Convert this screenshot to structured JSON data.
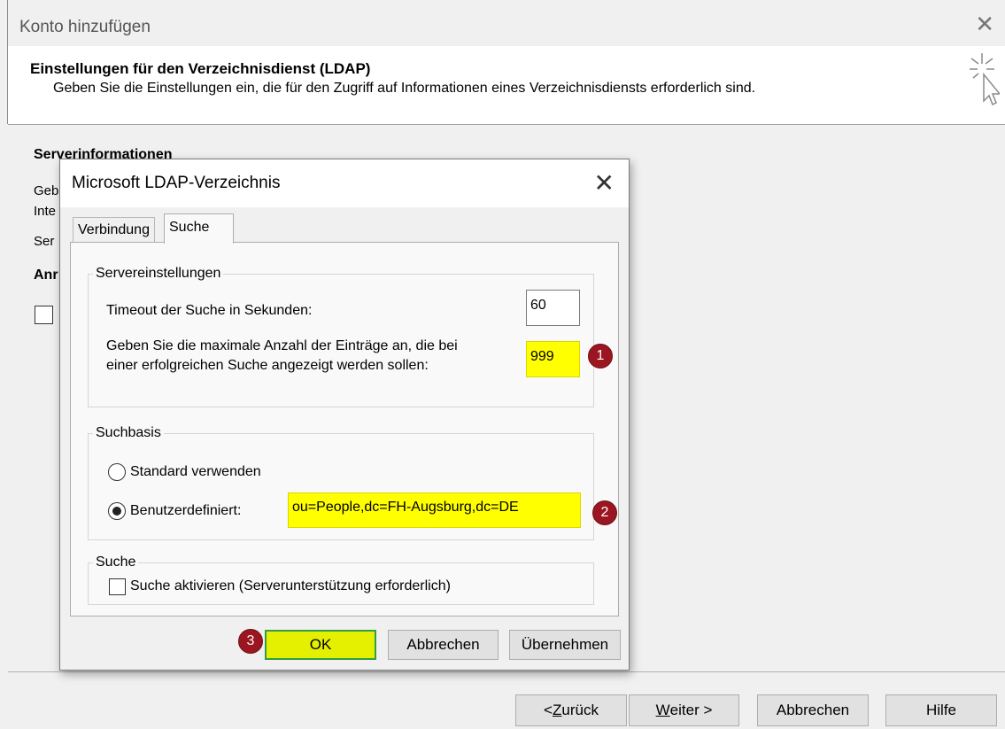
{
  "wizard": {
    "title": "Konto hinzufügen",
    "header_title": "Einstellungen für den Verzeichnisdienst (LDAP)",
    "header_subtitle": "Geben Sie die Einstellungen ein, die für den Zugriff auf Informationen eines Verzeichnisdiensts erforderlich sind.",
    "section_heading": "Serverinformationen",
    "partial_texts": [
      "Geb",
      "Inte",
      "Ser",
      "Anr"
    ],
    "buttons": {
      "back": "< Zurück",
      "next": "Weiter >",
      "cancel": "Abbrechen",
      "help": "Hilfe"
    },
    "back_prefix": "< ",
    "back_u": "Z",
    "back_rest": "urück",
    "next_u": "W",
    "next_rest": "eiter >"
  },
  "dialog": {
    "title": "Microsoft LDAP-Verzeichnis",
    "tabs": [
      {
        "label": "Verbindung",
        "active": false
      },
      {
        "label": "Suche",
        "active": true
      }
    ],
    "server_settings": {
      "legend": "Servereinstellungen",
      "timeout_label": "Timeout der Suche in Sekunden:",
      "timeout_value": "60",
      "max_entries_label": "Geben Sie die maximale Anzahl der Einträge an, die bei einer erfolgreichen Suche angezeigt werden sollen:",
      "max_entries_value": "999"
    },
    "search_base": {
      "legend": "Suchbasis",
      "option_default": "Standard verwenden",
      "option_custom": "Benutzerdefiniert:",
      "selected": "custom",
      "custom_value": "ou=People,dc=FH-Augsburg,dc=DE"
    },
    "search": {
      "legend": "Suche",
      "enable_label": "Suche aktivieren (Serverunterstützung erforderlich)",
      "enabled": false
    },
    "buttons": {
      "ok": "OK",
      "cancel": "Abbrechen",
      "apply": "Übernehmen"
    }
  },
  "annotations": {
    "badge1": "1",
    "badge2": "2",
    "badge3": "3",
    "highlight_color": "#ffff00",
    "badge_color": "#9b1620"
  }
}
